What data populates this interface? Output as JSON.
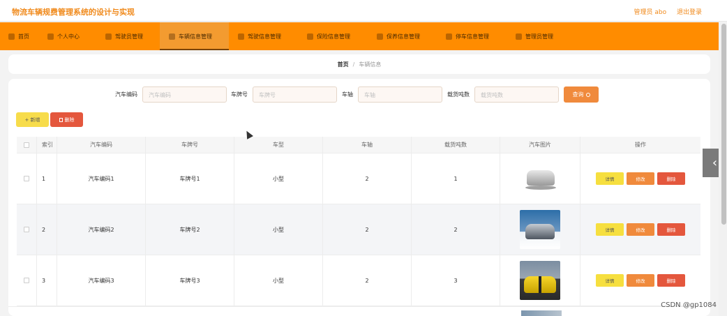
{
  "app": {
    "title": "物流车辆规费管理系统的设计与实现",
    "user_label": "管理员 abo",
    "logout_label": "退出登录",
    "accent_color": "#ff8c00"
  },
  "nav": {
    "items": [
      {
        "label": "首页",
        "icon": "home-icon"
      },
      {
        "label": "个人中心",
        "icon": "user-icon"
      },
      {
        "label": "驾驶员管理",
        "icon": "chart-icon"
      },
      {
        "label": "车辆信息管理",
        "icon": "document-icon",
        "active": true
      },
      {
        "label": "驾驶信息管理",
        "icon": "document-icon"
      },
      {
        "label": "保险信息管理",
        "icon": "shield-icon"
      },
      {
        "label": "保养信息管理",
        "icon": "shield-icon"
      },
      {
        "label": "停车信息管理",
        "icon": "document-icon"
      },
      {
        "label": "管理员管理",
        "icon": "admin-icon"
      }
    ]
  },
  "breadcrumb": {
    "home": "首页",
    "separator": "/",
    "current": "车辆信息"
  },
  "search": {
    "fields": [
      {
        "label": "汽车编码",
        "placeholder": "汽车编码"
      },
      {
        "label": "车牌号",
        "placeholder": "车牌号"
      },
      {
        "label": "车轴",
        "placeholder": "车轴"
      },
      {
        "label": "载货吨数",
        "placeholder": "载货吨数"
      }
    ],
    "button_label": "查询"
  },
  "toolbar": {
    "add_label": "+ 新增",
    "delete_label": "删除"
  },
  "table": {
    "headers": [
      "索引",
      "汽车编码",
      "车牌号",
      "车型",
      "车轴",
      "载货吨数",
      "汽车图片",
      "操作"
    ],
    "rows": [
      {
        "index": "1",
        "code": "汽车编码1",
        "plate": "车牌号1",
        "type": "小型",
        "axle": "2",
        "tonnage": "1",
        "image": "white-suv"
      },
      {
        "index": "2",
        "code": "汽车编码2",
        "plate": "车牌号2",
        "type": "小型",
        "axle": "2",
        "tonnage": "2",
        "image": "silver-suv"
      },
      {
        "index": "3",
        "code": "汽车编码3",
        "plate": "车牌号3",
        "type": "小型",
        "axle": "2",
        "tonnage": "3",
        "image": "yellow-car"
      }
    ],
    "actions": {
      "detail": "详情",
      "edit": "修改",
      "remove": "删除"
    }
  },
  "watermark": "CSDN @gp1084"
}
